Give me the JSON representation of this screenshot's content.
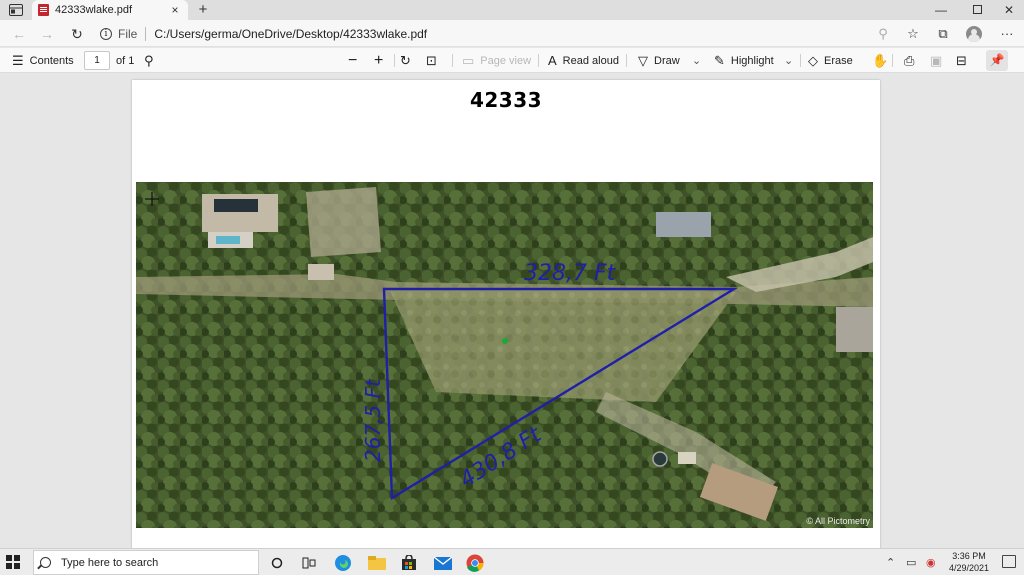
{
  "browser": {
    "tab_title": "42333wlake.pdf",
    "tab_close": "×",
    "new_tab": "+",
    "file_label": "File",
    "url": "C:/Users/germa/OneDrive/Desktop/42333wlake.pdf"
  },
  "pdf_toolbar": {
    "contents_label": "Contents",
    "page_current": "1",
    "page_total": "of 1",
    "page_view_label": "Page view",
    "read_aloud_label": "Read aloud",
    "draw_label": "Draw",
    "highlight_label": "Highlight",
    "erase_label": "Erase"
  },
  "document": {
    "heading": "42333",
    "annotations": {
      "top_side": "328,7 Ft",
      "left_side": "267,5 Ft",
      "hypotenuse": "430,8 Ft"
    },
    "copyright": "© All Pictometry"
  },
  "taskbar": {
    "search_placeholder": "Type here to search",
    "time": "3:36 PM",
    "date": "4/29/2021"
  },
  "colors": {
    "annotation_ink": "#1f1fa8",
    "marker": "#1fa63b",
    "vegetation": "#3e5128"
  }
}
